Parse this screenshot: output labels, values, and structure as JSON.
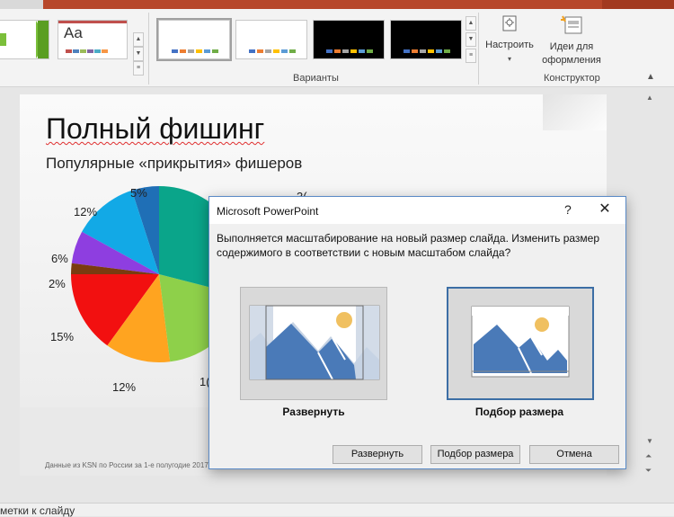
{
  "ribbon": {
    "groups": {
      "variants_label": "Варианты",
      "designer_label": "Конструктор"
    },
    "themes": [
      {
        "name": "green-theme-thumbnail",
        "sample": ""
      },
      {
        "name": "aa-theme-thumbnail",
        "sample": "Aa"
      }
    ],
    "variants": [
      {
        "background": "#ffffff",
        "swatches": [
          "#4472c4",
          "#ed7d31",
          "#a5a5a5",
          "#ffc000",
          "#5b9bd5",
          "#70ad47"
        ]
      },
      {
        "background": "#ffffff",
        "swatches": [
          "#4472c4",
          "#ed7d31",
          "#a5a5a5",
          "#ffc000",
          "#5b9bd5",
          "#70ad47"
        ]
      },
      {
        "background": "#000000",
        "swatches": [
          "#4472c4",
          "#ed7d31",
          "#a5a5a5",
          "#ffc000",
          "#5b9bd5",
          "#70ad47"
        ]
      },
      {
        "background": "#000000",
        "swatches": [
          "#4472c4",
          "#ed7d31",
          "#a5a5a5",
          "#ffc000",
          "#5b9bd5",
          "#70ad47"
        ]
      }
    ],
    "customize_label": "Настроить",
    "design_ideas_line1": "Идеи для",
    "design_ideas_line2": "оформления"
  },
  "slide": {
    "title": "Полный фишинг",
    "subtitle": "Популярные «прикрытия» фишеров",
    "footer": "Данные из KSN по России за 1-е полугодие 2017",
    "pie_labels": [
      "5%",
      "12%",
      "6%",
      "2%",
      "15%",
      "12%",
      "1(",
      "3("
    ]
  },
  "chart_data": {
    "type": "pie",
    "values": [
      5,
      12,
      6,
      2,
      15,
      12,
      19,
      29
    ],
    "colors": [
      "#1f6fb6",
      "#12a9e6",
      "#8e3ee0",
      "#7a3b10",
      "#f21010",
      "#ffa420",
      "#8ed04a",
      "#0aa58a"
    ]
  },
  "status": {
    "text": "метки к слайду"
  },
  "dialog": {
    "title": "Microsoft PowerPoint",
    "help": "?",
    "close": "✕",
    "message": "Выполняется масштабирование на новый размер слайда. Изменить размер содержимого в соответствии с новым масштабом слайда?",
    "option_maximize": "Развернуть",
    "option_fit": "Подбор размера",
    "buttons": {
      "maximize": "Развернуть",
      "fit": "Подбор размера",
      "cancel": "Отмена"
    }
  }
}
